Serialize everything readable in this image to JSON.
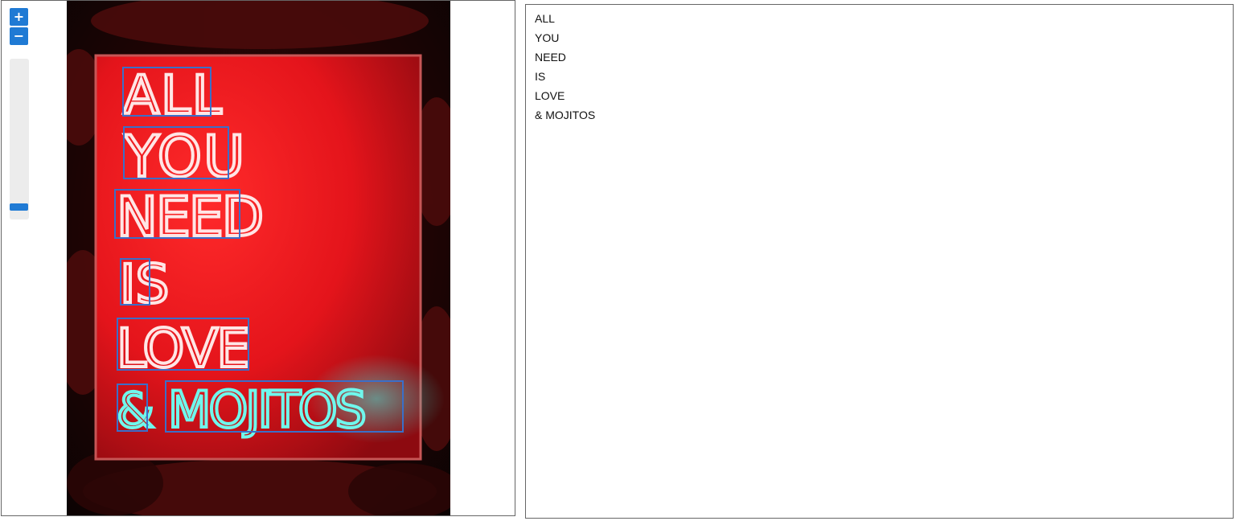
{
  "viewer": {
    "zoom_in_label": "+",
    "zoom_out_label": "−",
    "zoom_level": 0.05
  },
  "photo": {
    "description_icon": "neon-sign-photo",
    "words": [
      "ALL",
      "YOU",
      "NEED",
      "IS",
      "LOVE",
      "&",
      "MOJITOS"
    ],
    "colors": {
      "neon_red": "#ff3a3a",
      "neon_cyan": "#41f0e4",
      "box_outline": "#3a6fc9"
    }
  },
  "text_output": {
    "lines": [
      "ALL",
      "YOU",
      "NEED",
      "IS",
      "LOVE",
      "& MOJITOS"
    ]
  }
}
